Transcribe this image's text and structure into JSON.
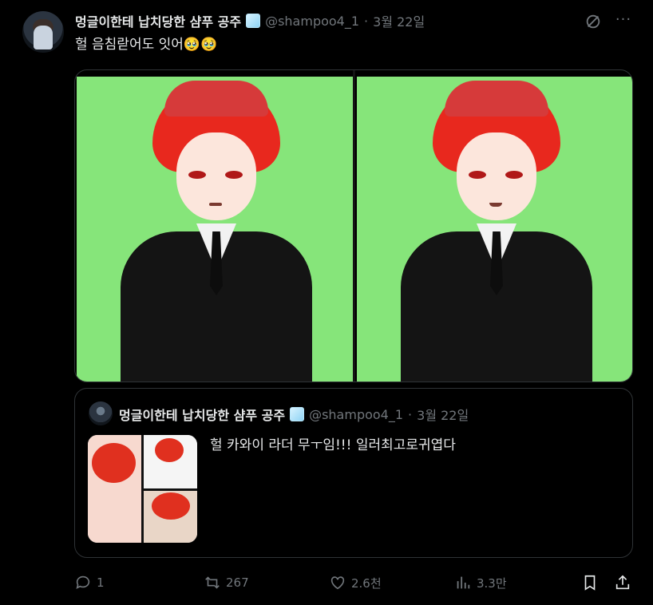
{
  "tweet": {
    "author_name": "멍글이한테 납치당한 샴푸 공주",
    "handle": "@shampoo4_1",
    "separator": "·",
    "date": "3월 22일",
    "text": "헐 음침랃어도 잇어🥹🥹"
  },
  "quoted": {
    "author_name": "멍글이한테 납치당한 샴푸 공주",
    "handle": "@shampoo4_1",
    "separator": "·",
    "date": "3월 22일",
    "text": "헐 카와이 라더 무ㅜ임!!! 일러최고로귀엽다"
  },
  "actions": {
    "reply_count": "1",
    "retweet_count": "267",
    "like_count": "2.6천",
    "view_count": "3.3만"
  },
  "icons": {
    "grok": "grok-icon",
    "more": "more-icon",
    "reply": "reply-icon",
    "retweet": "retweet-icon",
    "like": "heart-icon",
    "views": "views-icon",
    "bookmark": "bookmark-icon",
    "share": "share-icon",
    "verified_badge": "ice-cube-icon"
  },
  "colors": {
    "background": "#000000",
    "text": "#e7e9ea",
    "muted": "#71767b",
    "border": "#2f3336",
    "green_screen": "#86e57a"
  },
  "more_label": "···"
}
